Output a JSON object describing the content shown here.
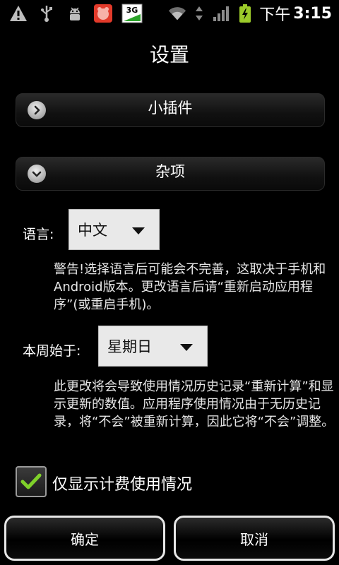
{
  "status_bar": {
    "network": "3G",
    "ampm": "下午",
    "time": "3:15"
  },
  "title": "设置",
  "sections": [
    {
      "label": "小插件",
      "state": "collapsed"
    },
    {
      "label": "杂项",
      "state": "expanded"
    }
  ],
  "language": {
    "label": "语言:",
    "value": "中文",
    "note": "警告!选择语言后可能会不完善，这取决于手机和Android版本。更改语言后请“重新启动应用程序”(或重启手机)。"
  },
  "week_start": {
    "label": "本周始于:",
    "value": "星期日",
    "note": "此更改将会导致使用情况历史记录“重新计算”和显示更新的数值。应用程序使用情况由于无历史记录，将“不会”被重新计算，因此它将“不会”调整。"
  },
  "billable_only": {
    "label": "仅显示计费使用情况",
    "checked": true
  },
  "buttons": {
    "ok": "确定",
    "cancel": "取消"
  }
}
